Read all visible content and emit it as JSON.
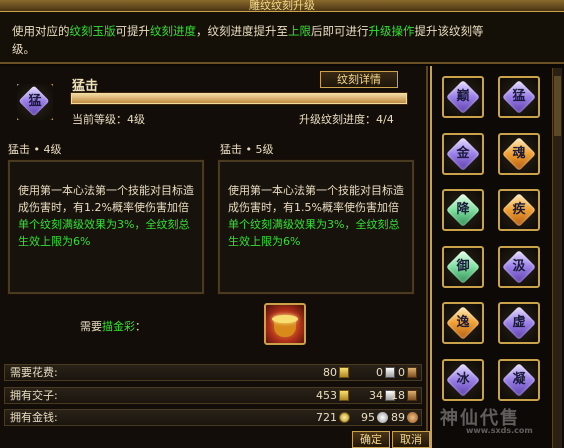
{
  "window": {
    "title": "雕纹纹刻升级"
  },
  "intro": {
    "p1": "使用对应的",
    "k1": "纹刻玉版",
    "p2": "可提升",
    "k2": "纹刻进度",
    "p3": "，纹刻进度提升至",
    "k3": "上限",
    "p4": "后即可进行",
    "k4": "升级操作",
    "p5": "提升该纹刻等",
    "p6": "级。"
  },
  "skill": {
    "name": "猛击",
    "icon_char": "猛",
    "detail_button": "纹刻详情",
    "level_text": "当前等级：4级",
    "progress_text": "升级纹刻进度：4/4",
    "progress_fraction": 1.0
  },
  "current": {
    "heading": "猛击 • 4级",
    "desc": "使用第一本心法第一个技能对目标造成伤害时，有1.2%概率使伤害加倍",
    "bonus": "单个纹刻满级效果为3%，全纹刻总生效上限为6%"
  },
  "next": {
    "heading": "猛击 • 5级",
    "desc": "使用第一本心法第一个技能对目标造成伤害时，有1.5%概率使伤害加倍",
    "bonus": "单个纹刻满级效果为3%，全纹刻总生效上限为6%"
  },
  "need": {
    "label_prefix": "需要",
    "item": "描金彩",
    "label_suffix": "："
  },
  "rows": {
    "cost": {
      "label": "需要花费:",
      "v1": "80",
      "v2": "0",
      "v3": "0"
    },
    "owned": {
      "label": "拥有交子:",
      "v1": "453",
      "v2": "34",
      "v3": "18"
    },
    "money": {
      "label": "拥有金钱:",
      "v1": "721",
      "v2": "95",
      "v3": "89"
    }
  },
  "buttons": {
    "confirm": "确定",
    "cancel": "取消"
  },
  "gems": [
    {
      "char": "巅",
      "color": "purple"
    },
    {
      "char": "猛",
      "color": "purple"
    },
    {
      "char": "金",
      "color": "purple"
    },
    {
      "char": "魂",
      "color": "orange"
    },
    {
      "char": "降",
      "color": "green"
    },
    {
      "char": "疾",
      "color": "orange"
    },
    {
      "char": "御",
      "color": "green"
    },
    {
      "char": "汲",
      "color": "purple"
    },
    {
      "char": "逸",
      "color": "orange"
    },
    {
      "char": "虚",
      "color": "purple"
    },
    {
      "char": "冰",
      "color": "purple"
    },
    {
      "char": "凝",
      "color": "purple"
    }
  ],
  "watermark": {
    "main": "神仙代售",
    "sub": "www.sxds.com"
  }
}
